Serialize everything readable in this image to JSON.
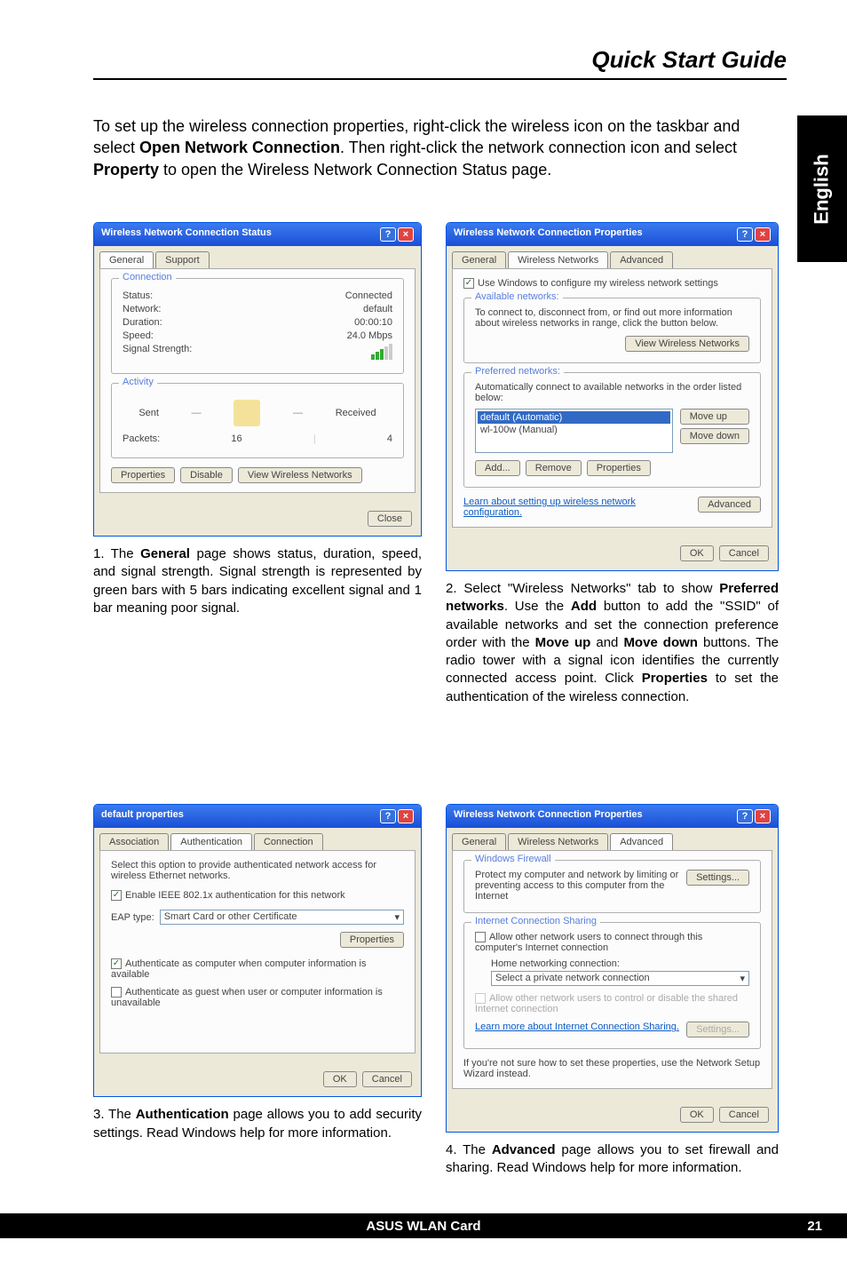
{
  "header": {
    "title": "Quick Start Guide"
  },
  "sideTab": "English",
  "intro": {
    "text1": "To set up the wireless connection properties, right-click the wireless icon on the taskbar and select ",
    "bold1": "Open Network Connection",
    "text2": ". Then right-click the network connection icon and select ",
    "bold2": "Property",
    "text3": " to open the Wireless Network Connection Status page."
  },
  "dlg1": {
    "title": "Wireless Network Connection Status",
    "tabs": {
      "general": "General",
      "support": "Support"
    },
    "grpConn": "Connection",
    "status_lbl": "Status:",
    "status_val": "Connected",
    "net_lbl": "Network:",
    "net_val": "default",
    "dur_lbl": "Duration:",
    "dur_val": "00:00:10",
    "spd_lbl": "Speed:",
    "spd_val": "24.0 Mbps",
    "sig_lbl": "Signal Strength:",
    "grpAct": "Activity",
    "sent": "Sent",
    "recv": "Received",
    "pkt_lbl": "Packets:",
    "pkt_sent": "16",
    "pkt_recv": "4",
    "btn_prop": "Properties",
    "btn_dis": "Disable",
    "btn_view": "View Wireless Networks",
    "btn_close": "Close"
  },
  "cap1": {
    "num": "1. The ",
    "b1": "General",
    "rest": " page shows status, duration, speed, and signal strength. Signal strength is represented by green bars with 5 bars indicating excellent signal and 1 bar meaning poor signal."
  },
  "dlg2": {
    "title": "Wireless Network Connection Properties",
    "tabs": {
      "general": "General",
      "wn": "Wireless Networks",
      "adv": "Advanced"
    },
    "useWin": "Use Windows to configure my wireless network settings",
    "grpAvail": "Available networks:",
    "availText": "To connect to, disconnect from, or find out more information about wireless networks in range, click the button below.",
    "btnViewW": "View Wireless Networks",
    "grpPref": "Preferred networks:",
    "prefText": "Automatically connect to available networks in the order listed below:",
    "item1": "default (Automatic)",
    "item2": "wl-100w (Manual)",
    "btnUp": "Move up",
    "btnDown": "Move down",
    "btnAdd": "Add...",
    "btnRem": "Remove",
    "btnProp": "Properties",
    "learn": "Learn about setting up wireless network configuration.",
    "btnAdv": "Advanced",
    "btnOK": "OK",
    "btnCancel": "Cancel"
  },
  "cap2": {
    "num": "2. Select \"Wireless Networks\" tab to show ",
    "b1": "Preferred networks",
    "t1": ". Use the ",
    "b2": "Add",
    "t2": " button to add the \"SSID\" of available networks and set the connection preference order with the ",
    "b3": "Move up",
    "t3": " and ",
    "b4": "Move down",
    "t4": " buttons. The radio tower with a signal icon identifies the currently connected access point. Click ",
    "b5": "Properties",
    "t5": " to set the authentication of the wireless connection."
  },
  "dlg3": {
    "title": "default properties",
    "tabs": {
      "assoc": "Association",
      "auth": "Authentication",
      "conn": "Connection"
    },
    "chk1": "Select this option to provide authenticated network access for wireless Ethernet networks.",
    "chk2": "Enable IEEE 802.1x authentication for this network",
    "eap_lbl": "EAP type:",
    "eap_val": "Smart Card or other Certificate",
    "btnProp": "Properties",
    "chk3": "Authenticate as computer when computer information is available",
    "chk4": "Authenticate as guest when user or computer information is unavailable",
    "btnOK": "OK",
    "btnCancel": "Cancel"
  },
  "cap3": {
    "num": "3. The ",
    "b1": "Authentication",
    "rest": " page allows you to add security settings. Read Windows help for more information."
  },
  "dlg4": {
    "title": "Wireless Network Connection Properties",
    "tabs": {
      "general": "General",
      "wn": "Wireless Networks",
      "adv": "Advanced"
    },
    "grpFw": "Windows Firewall",
    "fwText": "Protect my computer and network by limiting or preventing access to this computer from the Internet",
    "btnSet": "Settings...",
    "grpIcs": "Internet Connection Sharing",
    "ics1": "Allow other network users to connect through this computer's Internet connection",
    "ics_home": "Home networking connection:",
    "ics_sel": "Select a private network connection",
    "ics2": "Allow other network users to control or disable the shared Internet connection",
    "icsLearn": "Learn more about Internet Connection Sharing.",
    "btnSet2": "Settings...",
    "wizText": "If you're not sure how to set these properties, use the Network Setup Wizard instead.",
    "wizLink": "Network Setup Wizard",
    "btnOK": "OK",
    "btnCancel": "Cancel"
  },
  "cap4": {
    "num": "4. The ",
    "b1": "Advanced",
    "rest": " page allows you to set firewall and sharing. Read Windows help for more information."
  },
  "footer": {
    "title": "ASUS WLAN Card",
    "page": "21"
  }
}
